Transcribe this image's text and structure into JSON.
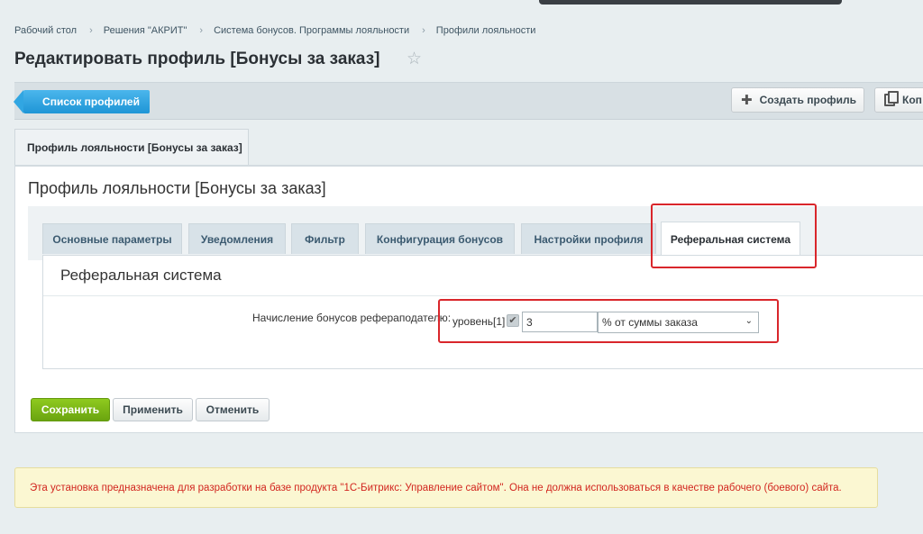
{
  "breadcrumb": [
    "Рабочий стол",
    "Решения \"АКРИТ\"",
    "Система бонусов. Программы лояльности",
    "Профили лояльности"
  ],
  "page_title": "Редактировать профиль [Бонусы за заказ]",
  "toolbar": {
    "list_button": "Список профилей",
    "create_button": "Создать профиль",
    "copy_button": "Коп"
  },
  "outer_tab": "Профиль лояльности [Бонусы за заказ]",
  "panel_title": "Профиль лояльности [Бонусы за заказ]",
  "inner_tabs": [
    "Основные параметры",
    "Уведомления",
    "Фильтр",
    "Конфигурация бонусов",
    "Настройки профиля",
    "Реферальная система"
  ],
  "section": {
    "title": "Реферальная система",
    "field_label": "Начисление бонусов рефераподателю:",
    "level_label": "уровень[1]",
    "level_checked": true,
    "amount_value": "3",
    "mode_selected": "% от суммы заказа"
  },
  "buttons": {
    "save": "Сохранить",
    "apply": "Применить",
    "cancel": "Отменить"
  },
  "warning": "Эта установка предназначена для разработки на базе продукта \"1С-Битрикс: Управление сайтом\". Она не должна использоваться в качестве рабочего (боевого) сайта.",
  "colors": {
    "highlight": "#d9262b",
    "primary_blue": "#1e95d6",
    "save_green": "#6aa40f",
    "warning_text": "#d2261f"
  }
}
